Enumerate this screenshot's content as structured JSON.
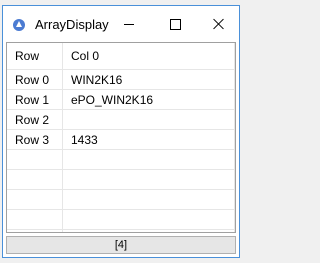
{
  "window": {
    "title": "ArrayDisplay"
  },
  "grid": {
    "corner_label": "Row",
    "columns": [
      "Col 0"
    ],
    "rows": [
      {
        "header": "Row 0",
        "cells": [
          "WIN2K16"
        ]
      },
      {
        "header": "Row 1",
        "cells": [
          "ePO_WIN2K16"
        ]
      },
      {
        "header": "Row 2",
        "cells": [
          ""
        ]
      },
      {
        "header": "Row 3",
        "cells": [
          "1433"
        ]
      }
    ]
  },
  "status": {
    "text": "[4]"
  }
}
